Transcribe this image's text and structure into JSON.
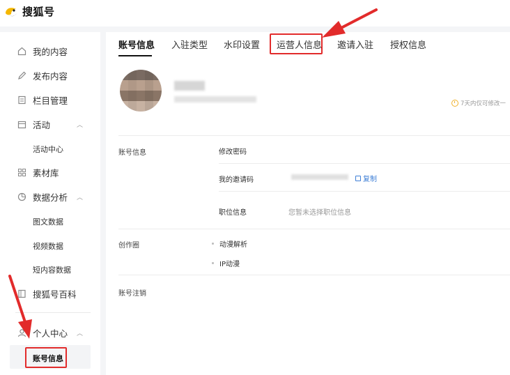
{
  "app": {
    "brand_name": "搜狐号",
    "accent_color": "#e22b2b",
    "logo_color": "#f5b700"
  },
  "sidebar": {
    "items": [
      {
        "label": "我的内容",
        "icon": "home-icon"
      },
      {
        "label": "发布内容",
        "icon": "pencil-icon"
      },
      {
        "label": "栏目管理",
        "icon": "document-icon"
      },
      {
        "label": "活动",
        "icon": "calendar-icon",
        "expanded": true,
        "children": [
          "活动中心"
        ]
      },
      {
        "label": "素材库",
        "icon": "grid-icon"
      },
      {
        "label": "数据分析",
        "icon": "pie-chart-icon",
        "expanded": true,
        "children": [
          "图文数据",
          "视频数据",
          "短内容数据"
        ]
      },
      {
        "label": "搜狐号百科",
        "icon": "book-icon"
      },
      {
        "label": "个人中心",
        "icon": "user-icon",
        "expanded": true,
        "children": [
          "账号信息"
        ],
        "active_child": "账号信息"
      }
    ]
  },
  "tabs": [
    {
      "label": "账号信息",
      "active": true
    },
    {
      "label": "入驻类型",
      "active": false
    },
    {
      "label": "水印设置",
      "active": false
    },
    {
      "label": "运营人信息",
      "active": false,
      "highlighted": true
    },
    {
      "label": "邀请入驻",
      "active": false
    },
    {
      "label": "授权信息",
      "active": false
    }
  ],
  "profile": {
    "edit_note": "7天内仅可修改一"
  },
  "account_section": {
    "label": "账号信息",
    "fields": [
      {
        "label": "修改密码",
        "value": ""
      },
      {
        "label": "我的邀请码",
        "value": "",
        "action": "复制"
      },
      {
        "label": "职位信息",
        "value": "您暂未选择职位信息"
      }
    ]
  },
  "creation_section": {
    "label": "创作圈",
    "items": [
      "动漫解析",
      "IP动漫"
    ]
  },
  "cancel_section": {
    "label": "账号注销"
  }
}
